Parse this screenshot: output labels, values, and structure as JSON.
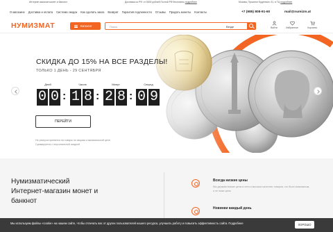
{
  "topbar": {
    "item1": "Интернет-магазин монет и банкнот",
    "item2": "Доставка из РФ: от 5000 рублей Почтой РФ бесплатно",
    "item2_link": "подробнее",
    "item3": "Москва, Проспект Буденного 31, в ТЦ",
    "item3_link": "подробнее"
  },
  "menu": {
    "items": [
      "О магазине",
      "Доставка и оплата",
      "Система скидок",
      "Как сделать заказ",
      "Возврат",
      "Гарантия подлинности",
      "Отзывы",
      "Продать монеты",
      "Контакты"
    ],
    "phone": "+7 (985) 808-91-60",
    "email": "mail@numizm.at"
  },
  "header": {
    "logo": "НУМИЗМАТ",
    "catalog_label": "Каталог",
    "search_placeholder": "Поиск",
    "search_scope": "Везде",
    "icons": [
      {
        "name": "login-icon",
        "label": "Войти"
      },
      {
        "name": "favorites-icon",
        "label": "Избранное"
      },
      {
        "name": "cart-icon",
        "label": "Корзина"
      }
    ]
  },
  "hero": {
    "title": "СКИДКА ДО 15% НА ВСЕ РАЗДЕЛЫ!",
    "subtitle": "ТОЛЬКО 1 ДЕНЬ - 29 СЕНТЯБРЯ",
    "countdown": {
      "labels": [
        "Дней",
        "Часов",
        "Минут",
        "Секунд"
      ],
      "digits": [
        "0",
        "0",
        "1",
        "8",
        "2",
        "8",
        "0",
        "9"
      ]
    },
    "cta": "ПЕРЕЙТИ",
    "disclaimer_line1": "Не распространяется на товары по акциям и минимальной цене.",
    "disclaimer_line2": "Суммируется с персональной скидкой"
  },
  "about": {
    "title": "Нумизматический Интернет-магазин монет и банкнот",
    "features": [
      {
        "title": "Всегда низкие цены",
        "desc": "Мы держим низкие цены в сети и высокое качество товаров, что было возможным, а не ниже цены"
      },
      {
        "title": "Новинки каждый день",
        "desc": ""
      }
    ]
  },
  "cookie": {
    "text_before": "Мы используем файлы «cookie» на нашем сайте, чтобы отличать вас от других пользователей нашего ресурса, улучшить работу и повысить эффективность сайта.",
    "link": "Подробнее",
    "ok": "ХОРОШО"
  },
  "colors": {
    "accent": "#f26522",
    "dark": "#1e1e1e",
    "cookie_bg": "#3a3a3a"
  }
}
